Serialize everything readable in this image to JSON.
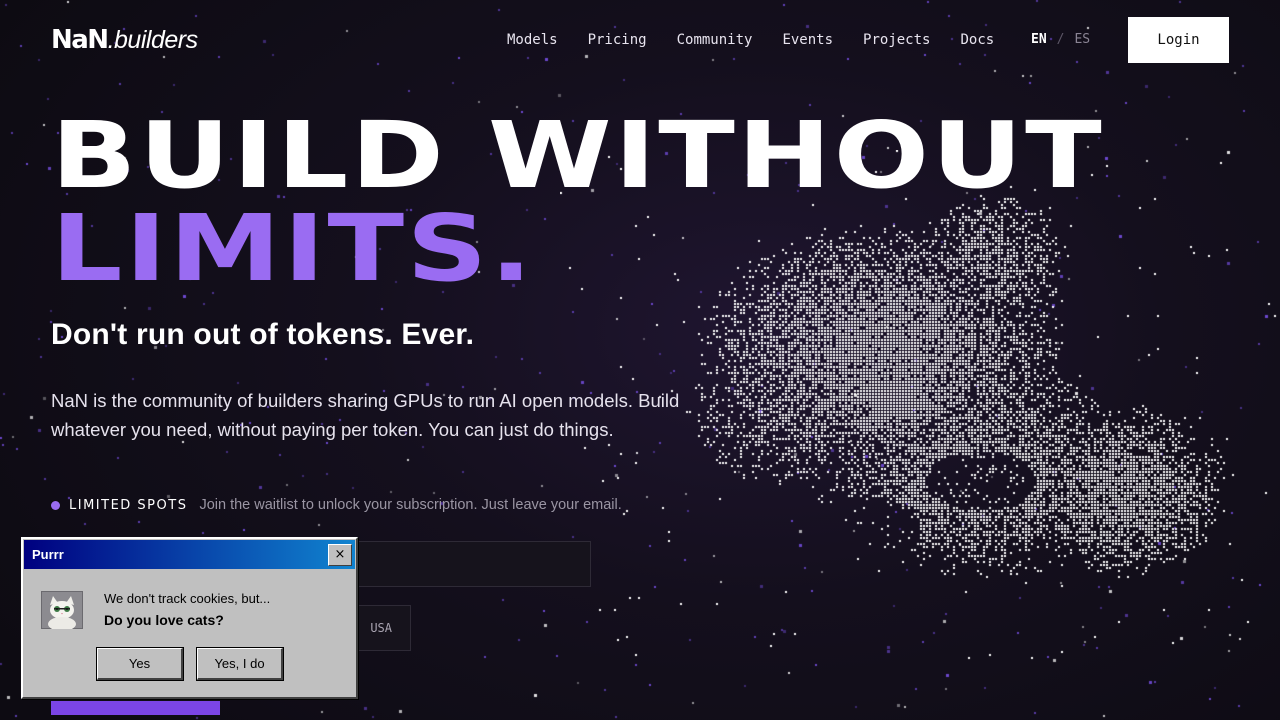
{
  "brand": {
    "mark": "NaN",
    "text": ".builders"
  },
  "nav": {
    "items": [
      "Models",
      "Pricing",
      "Community",
      "Events",
      "Projects",
      "Docs"
    ]
  },
  "lang": {
    "en": "EN",
    "separator": "/",
    "es": "ES"
  },
  "login": {
    "label": "Login"
  },
  "hero": {
    "line1": "BUILD WITHOUT",
    "line2": "LIMITS.",
    "subtitle": "Don't run out of tokens. Ever.",
    "description": "NaN is the community of builders sharing GPUs to run AI open models. Build whatever you need, without paying per token. You can just do things."
  },
  "waitlist": {
    "badge": "LIMITED SPOTS",
    "note": "Join the waitlist to unlock your subscription. Just leave your email.",
    "email_value": "",
    "country_value": "USA"
  },
  "dialog": {
    "title": "Purrr",
    "close_label": "×",
    "line1": "We don't track cookies, but...",
    "line2": "Do you love cats?",
    "btn_yes": "Yes",
    "btn_yes2": "Yes, I do",
    "icon": "cat-icon"
  },
  "colors": {
    "accent": "#9a6cf2",
    "cta": "#7b45e6",
    "background": "#0d0b12"
  }
}
